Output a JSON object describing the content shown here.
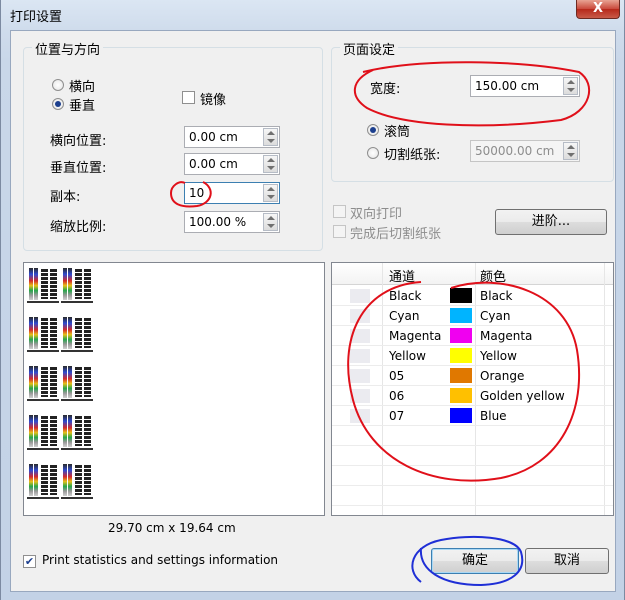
{
  "window": {
    "title": "打印设置",
    "close_label": "X"
  },
  "position_group": {
    "legend": "位置与方向",
    "landscape_label": "横向",
    "portrait_label": "垂直",
    "mirror_label": "镜像",
    "h_position_label": "横向位置:",
    "h_position_value": "0.00 cm",
    "v_position_label": "垂直位置:",
    "v_position_value": "0.00 cm",
    "copies_label": "副本:",
    "copies_value": "10",
    "scale_label": "缩放比例:",
    "scale_value": "100.00 %"
  },
  "page_group": {
    "legend": "页面设定",
    "width_label": "宽度:",
    "width_value": "150.00 cm",
    "roll_label": "滚筒",
    "cut_label": "切割纸张:",
    "cut_value": "50000.00 cm"
  },
  "options": {
    "bidirectional_label": "双向打印",
    "cut_after_label": "完成后切割纸张",
    "advanced_label": "进阶..."
  },
  "preview": {
    "dimensions": "29.70 cm x 19.64 cm"
  },
  "channels": {
    "header_channel": "通道",
    "header_color": "颜色",
    "rows": [
      {
        "channel": "Black",
        "color_name": "Black",
        "swatch": "#000000"
      },
      {
        "channel": "Cyan",
        "color_name": "Cyan",
        "swatch": "#00b4ff"
      },
      {
        "channel": "Magenta",
        "color_name": "Magenta",
        "swatch": "#f000f0"
      },
      {
        "channel": "Yellow",
        "color_name": "Yellow",
        "swatch": "#ffff00"
      },
      {
        "channel": "05",
        "color_name": "Orange",
        "swatch": "#e07800"
      },
      {
        "channel": "06",
        "color_name": "Golden yellow",
        "swatch": "#ffc000"
      },
      {
        "channel": "07",
        "color_name": "Blue",
        "swatch": "#0000ff"
      }
    ]
  },
  "footer": {
    "print_stats_label": "Print statistics and settings information",
    "ok_label": "确定",
    "cancel_label": "取消"
  },
  "colors": {
    "annotation_red": "#e0101a",
    "annotation_blue": "#1f2fd6"
  }
}
